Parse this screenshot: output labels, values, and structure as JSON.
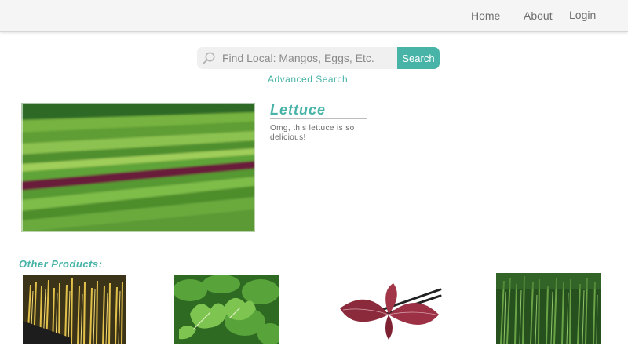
{
  "nav": {
    "home": "Home",
    "about": "About",
    "login": "Login"
  },
  "search": {
    "placeholder": "Find Local: Mangos, Eggs, Etc.",
    "button_label": "Search",
    "advanced_label": "Advanced Search"
  },
  "product": {
    "title": "Lettuce",
    "description": "Omg, this lettuce is so delicious!",
    "image_subject": "lettuce field rows"
  },
  "other_products": {
    "heading": "Other Products:",
    "items": [
      {
        "image_subject": "bean sprouts"
      },
      {
        "image_subject": "parsley"
      },
      {
        "image_subject": "red shiso leaves"
      },
      {
        "image_subject": "rosemary"
      }
    ]
  },
  "colors": {
    "accent": "#48b3a7",
    "navbar_bg": "#f5f5f5",
    "nav_text": "#6f6f6f"
  }
}
